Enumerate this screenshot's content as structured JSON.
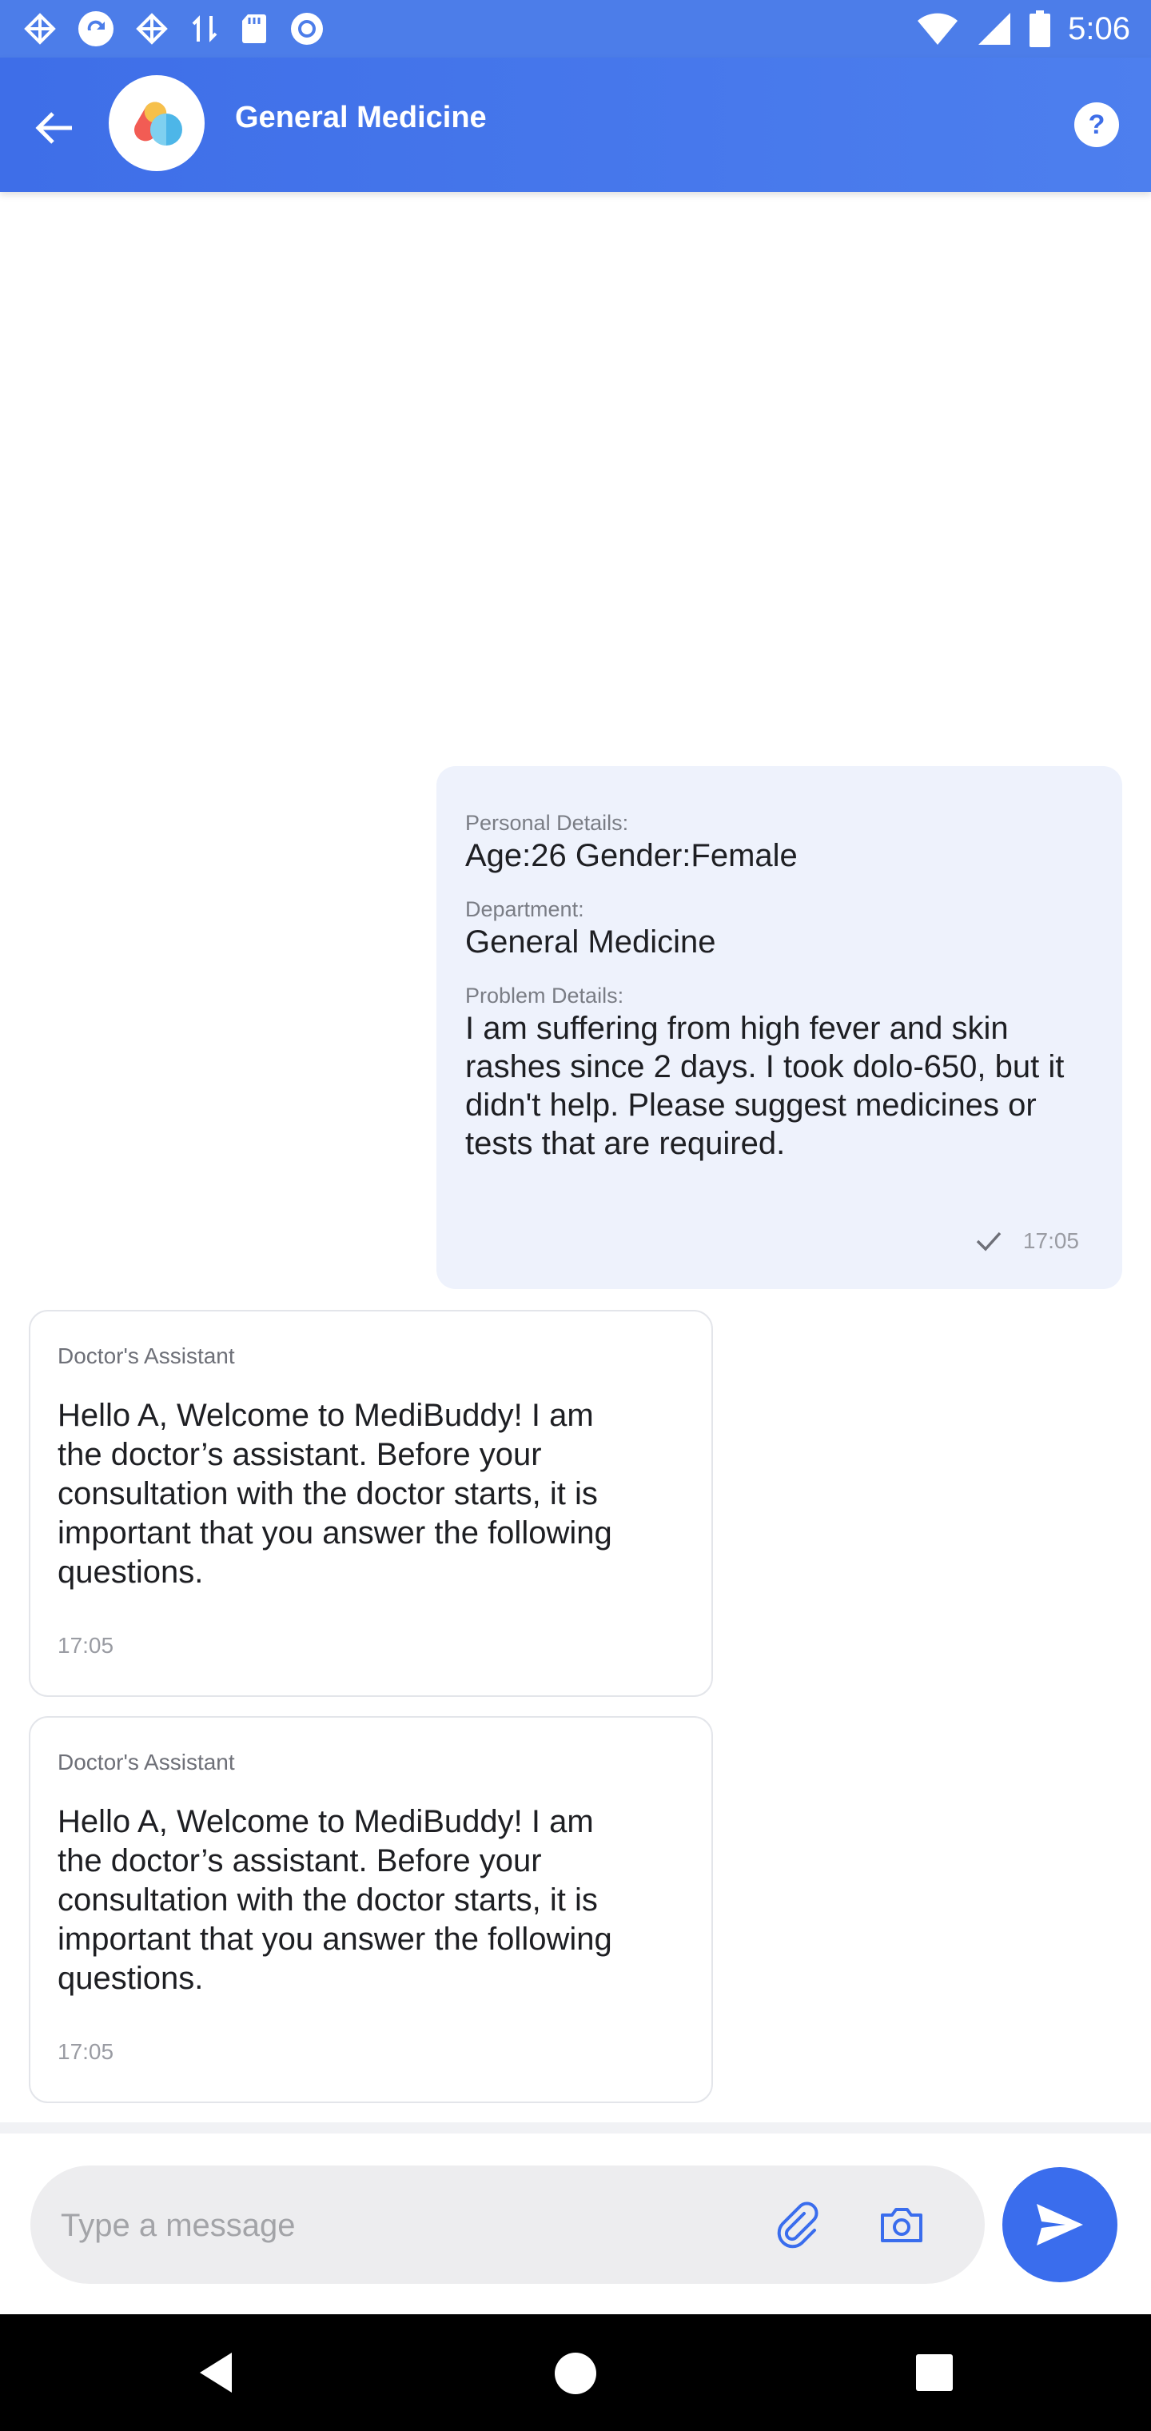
{
  "status_bar": {
    "time": "5:06",
    "left_icons": [
      "app-grid-icon",
      "sync-icon",
      "app-grid-icon",
      "data-transfer-icon",
      "sd-card-icon",
      "record-icon"
    ],
    "right_icons": [
      "wifi-icon",
      "signal-icon",
      "battery-icon"
    ]
  },
  "header": {
    "title": "General Medicine",
    "help_label": "?"
  },
  "outgoing_message": {
    "personal_label": "Personal Details:",
    "personal_value": "Age:26 Gender:Female",
    "department_label": "Department:",
    "department_value": "General Medicine",
    "problem_label": "Problem Details:",
    "problem_value": "I am suffering from high fever and skin rashes since 2 days. I took dolo-650, but it didn't help. Please suggest medicines or tests that are required.",
    "time": "17:05"
  },
  "incoming_messages": [
    {
      "sender": "Doctor's Assistant",
      "text": "Hello A, Welcome to MediBuddy! I am the doctor’s assistant. Before your consultation with the doctor starts, it is important that you answer the following questions.",
      "time": "17:05"
    },
    {
      "sender": "Doctor's Assistant",
      "text": "Hello A, Welcome to MediBuddy! I am the doctor’s assistant. Before your consultation with the doctor starts, it is important that you answer the following questions.",
      "time": "17:05"
    }
  ],
  "composer": {
    "placeholder": "Type a message",
    "value": ""
  },
  "colors": {
    "app_bar": "#3e6ee8",
    "outgoing_bubble": "#eef2fc",
    "send_button": "#3a6ded"
  }
}
